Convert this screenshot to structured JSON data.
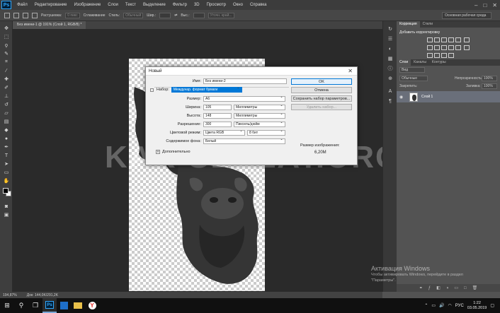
{
  "app": {
    "logo": "Ps",
    "menu": [
      "Файл",
      "Редактирование",
      "Изображение",
      "Слои",
      "Текст",
      "Выделение",
      "Фильтр",
      "3D",
      "Просмотр",
      "Окно",
      "Справка"
    ],
    "window_controls": [
      "–",
      "□",
      "✕"
    ]
  },
  "options": {
    "feather_label": "Растушевка:",
    "feather_value": "0 пикс",
    "antialias": "Сглаживание",
    "style_label": "Стиль:",
    "style_value": "Обычный",
    "width_label": "Шир.:",
    "height_label": "Выс.:",
    "refine": "Уточн. край...",
    "workspace": "Основная рабочая среда"
  },
  "document": {
    "tab_title": "Без имени-1 @ 191% (Слой 1, RGB/8) *"
  },
  "watermark": "KAK-SDELAT.ORG",
  "dialog": {
    "title": "Новый",
    "name_label": "Имя:",
    "name_value": "Без имени-2",
    "preset_label": "Набор:",
    "preset_value": "Междунар. формат бумаги",
    "size_label": "Размер:",
    "size_value": "A6",
    "width_label": "Ширина:",
    "width_value": "105",
    "width_unit": "Миллиметры",
    "height_label": "Высота:",
    "height_value": "148",
    "height_unit": "Миллиметры",
    "resolution_label": "Разрешение:",
    "resolution_value": "300",
    "resolution_unit": "Пиксель/дюйм",
    "color_mode_label": "Цветовой режим:",
    "color_mode_value": "Цвета RGB",
    "bit_depth": "8 бит",
    "bg_label": "Содержимое фона:",
    "bg_value": "Белый",
    "advanced": "Дополнительно",
    "ok": "OK",
    "cancel": "Отмена",
    "save_preset": "Сохранить набор параметров...",
    "delete_preset": "Удалить набор...",
    "image_size_label": "Размер изображения:",
    "image_size_value": "6,20M"
  },
  "right_panel": {
    "top_tabs": [
      "Коррекция",
      "Стили"
    ],
    "adjust_title": "Добавить корректировку",
    "layer_tabs": [
      "Слои",
      "Каналы",
      "Контуры"
    ],
    "filter_label": "Вид",
    "blend_mode": "Обычные",
    "opacity_label": "Непрозрачность:",
    "opacity_value": "100%",
    "lock_label": "Закрепить:",
    "fill_label": "Заливка:",
    "fill_value": "100%",
    "layer_name": "Слой 1"
  },
  "status": {
    "zoom": "194,87%",
    "doc_size": "Док: 144,0K/291,2K"
  },
  "activation": {
    "title": "Активация Windows",
    "line1": "Чтобы активировать Windows, перейдите в раздел",
    "line2": "\"Параметры\"."
  },
  "taskbar": {
    "language": "РУС",
    "time": "1:22",
    "date": "03.05.2019"
  }
}
